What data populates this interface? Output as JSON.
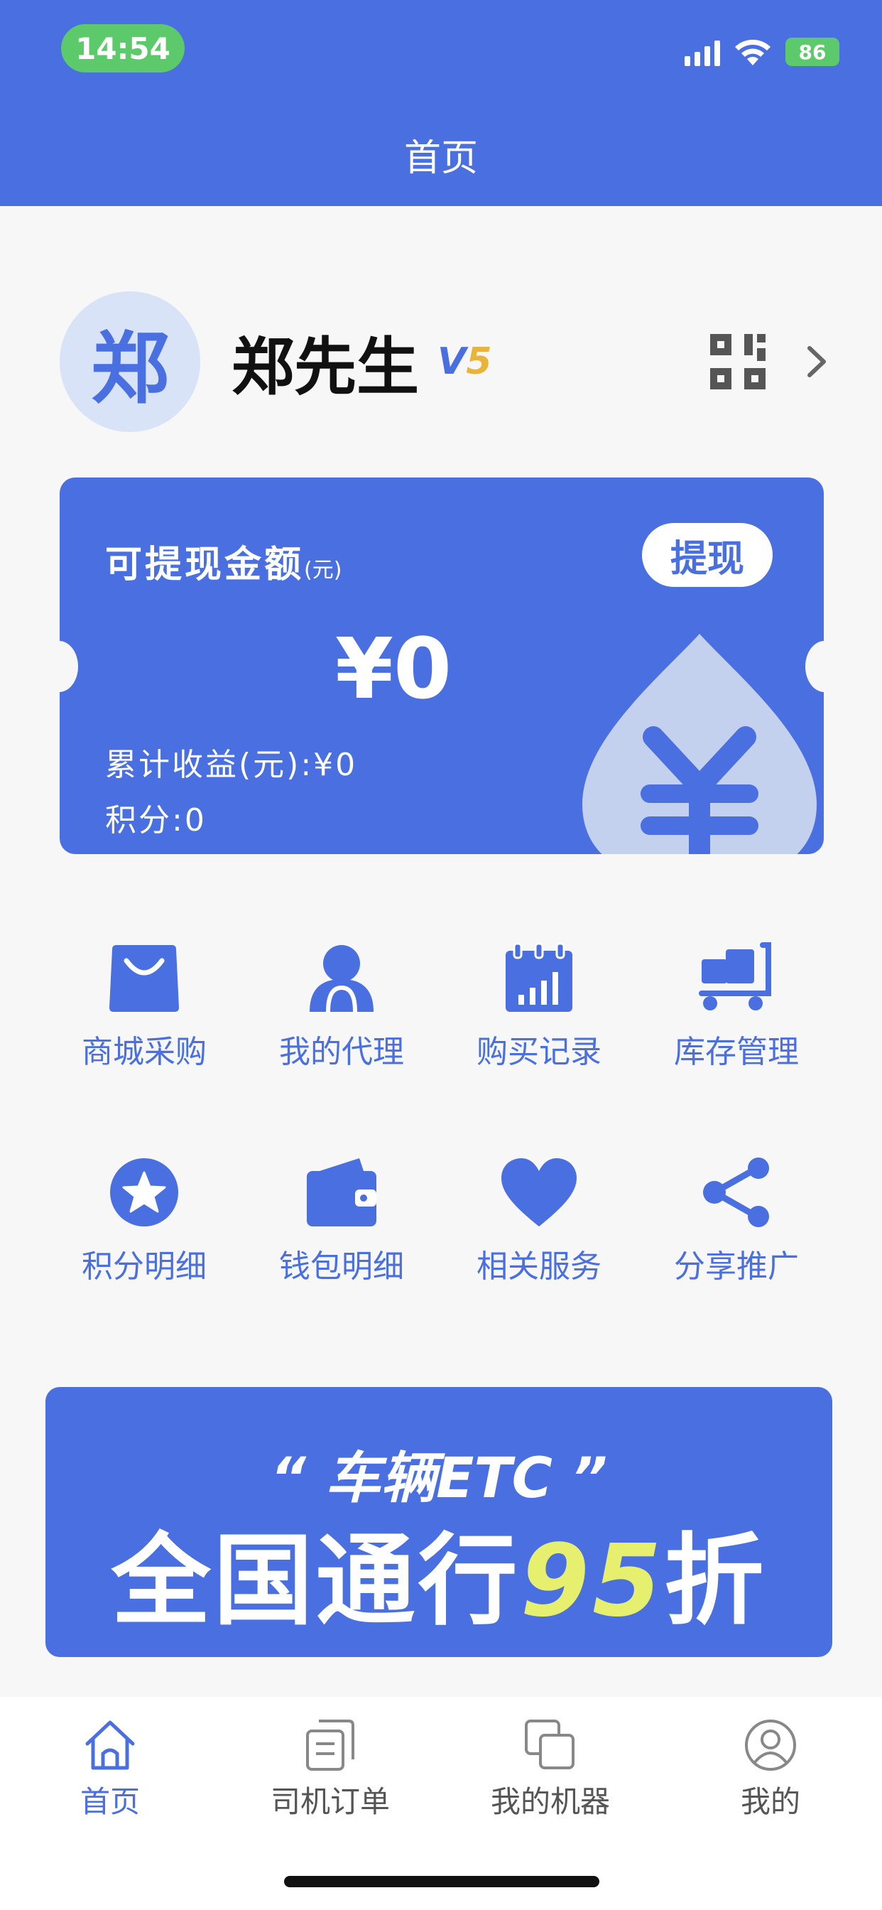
{
  "status_bar": {
    "time": "14:54",
    "battery": "86"
  },
  "header": {
    "title": "首页"
  },
  "profile": {
    "avatar_char": "郑",
    "name": "郑先生",
    "level_prefix": "V",
    "level_number": "5",
    "qr_icon": "qr-code-icon",
    "chevron_icon": "chevron-right-icon"
  },
  "balance_card": {
    "label": "可提现金额",
    "unit": "(元)",
    "withdraw_label": "提现",
    "amount": "¥0",
    "earnings": "累计收益(元):¥0",
    "points": "积分:0"
  },
  "grid": [
    {
      "label": "商城采购",
      "icon": "shopping-bag-icon"
    },
    {
      "label": "我的代理",
      "icon": "agent-person-icon"
    },
    {
      "label": "购买记录",
      "icon": "purchase-record-icon"
    },
    {
      "label": "库存管理",
      "icon": "inventory-cart-icon"
    },
    {
      "label": "积分明细",
      "icon": "star-points-icon"
    },
    {
      "label": "钱包明细",
      "icon": "wallet-icon"
    },
    {
      "label": "相关服务",
      "icon": "heart-service-icon"
    },
    {
      "label": "分享推广",
      "icon": "share-icon"
    }
  ],
  "banner": {
    "line1": "“ 车辆ETC ”",
    "line2_prefix": "全国通行",
    "line2_highlight": "95",
    "line2_suffix": "折"
  },
  "tabbar": [
    {
      "label": "首页",
      "icon": "home-icon",
      "active": true
    },
    {
      "label": "司机订单",
      "icon": "orders-icon",
      "active": false
    },
    {
      "label": "我的机器",
      "icon": "machines-icon",
      "active": false
    },
    {
      "label": "我的",
      "icon": "user-icon",
      "active": false
    }
  ],
  "colors": {
    "primary": "#4a6fe0",
    "status_green": "#5cc96a",
    "highlight": "#e6ef6e",
    "level_gold": "#e8b43a"
  }
}
